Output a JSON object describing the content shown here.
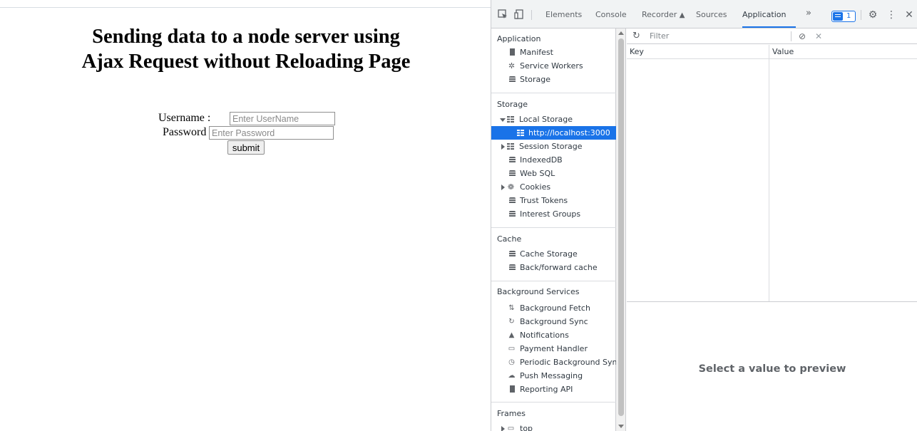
{
  "page": {
    "heading": "Sending data to a node server using Ajax Request without Reloading Page",
    "form": {
      "username_label": "Username :",
      "username_placeholder": "Enter UserName",
      "password_label": "Password :",
      "password_placeholder": "Enter Password",
      "submit_label": "submit"
    }
  },
  "devtools": {
    "tabs": [
      {
        "label": "Elements"
      },
      {
        "label": "Console"
      },
      {
        "label": "Recorder"
      },
      {
        "label": "Sources"
      },
      {
        "label": "Application",
        "active": true
      }
    ],
    "more_tabs_glyph": "»",
    "issues_count": "1",
    "accent_color": "#1a73e8",
    "sidebar": {
      "application": {
        "title": "Application",
        "items": [
          {
            "label": "Manifest",
            "icon": "document-icon"
          },
          {
            "label": "Service Workers",
            "icon": "gear-icon"
          },
          {
            "label": "Storage",
            "icon": "database-icon"
          }
        ]
      },
      "storage": {
        "title": "Storage",
        "items": [
          {
            "label": "Local Storage",
            "icon": "grid-icon",
            "expanded": true
          },
          {
            "label": "http://localhost:3000",
            "icon": "grid-icon",
            "selected": true
          },
          {
            "label": "Session Storage",
            "icon": "grid-icon",
            "expanded": false
          },
          {
            "label": "IndexedDB",
            "icon": "database-icon"
          },
          {
            "label": "Web SQL",
            "icon": "database-icon"
          },
          {
            "label": "Cookies",
            "icon": "cookie-icon",
            "expanded": false
          },
          {
            "label": "Trust Tokens",
            "icon": "database-icon"
          },
          {
            "label": "Interest Groups",
            "icon": "database-icon"
          }
        ]
      },
      "cache": {
        "title": "Cache",
        "items": [
          {
            "label": "Cache Storage",
            "icon": "database-icon"
          },
          {
            "label": "Back/forward cache",
            "icon": "database-icon"
          }
        ]
      },
      "background_services": {
        "title": "Background Services",
        "items": [
          {
            "label": "Background Fetch",
            "icon": "arrows-icon"
          },
          {
            "label": "Background Sync",
            "icon": "sync-icon"
          },
          {
            "label": "Notifications",
            "icon": "bell-icon"
          },
          {
            "label": "Payment Handler",
            "icon": "card-icon"
          },
          {
            "label": "Periodic Background Sync",
            "icon": "clock-icon"
          },
          {
            "label": "Push Messaging",
            "icon": "cloud-icon"
          },
          {
            "label": "Reporting API",
            "icon": "document-icon"
          }
        ]
      },
      "frames": {
        "title": "Frames",
        "items": [
          {
            "label": "top",
            "icon": "frame-icon",
            "expanded": false
          }
        ]
      }
    },
    "main": {
      "filter_placeholder": "Filter",
      "columns": [
        "Key",
        "Value"
      ],
      "rows": [],
      "preview_text": "Select a value to preview"
    }
  }
}
